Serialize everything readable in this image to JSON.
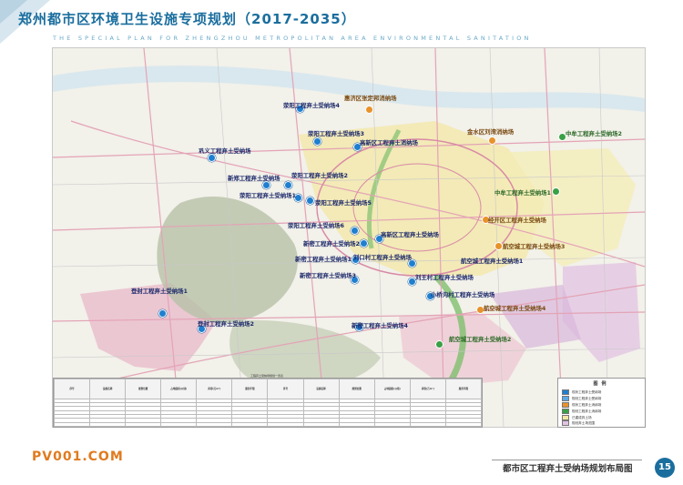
{
  "header": {
    "title": "郑州都市区环境卫生设施专项规划（2017-2035）",
    "subtitle": "THE SPECIAL PLAN FOR ZHENGZHOU METROPOLITAN AREA ENVIRONMENTAL SANITATION"
  },
  "map": {
    "labels": {
      "hjq": "惠济区张定邦消纳场",
      "xy4": "荥阳工程弃土受纳场4",
      "xy3": "荥阳工程弃土受纳场3",
      "gxq": "高新区工程弃土消纳场",
      "jsq": "金水区刘湾消纳场",
      "zm2": "中牟工程弃土受纳场2",
      "gy": "巩义工程弃土受纳场",
      "xz": "新郑工程弃土受纳场",
      "xy2": "荥阳工程弃土受纳场2",
      "xy1": "荥阳工程弃土受纳场1",
      "xy5": "荥阳工程弃土受纳场5",
      "zm1": "中牟工程弃土受纳场1",
      "gxq2": "高新区工程弃土受纳场",
      "jc": "经开区工程弃土受纳场",
      "hk3": "航空城工程弃土受纳场3",
      "xy6": "荥阳工程弃土受纳场6",
      "dq": "登封工程弃土受纳场",
      "xm2": "新密工程弃土受纳场2",
      "xm1": "新密工程弃土受纳场1",
      "lk": "刘口村工程弃土受纳场",
      "hk1": "航空城工程弃土受纳场1",
      "xm3": "新密工程弃土受纳场3",
      "lwc": "刘王村工程弃土受纳场",
      "xh": "小桥沟村工程弃土受纳场",
      "df1": "登封工程弃土受纳场1",
      "df2": "登封工程弃土受纳场2",
      "hk4": "航空城工程弃土受纳场4",
      "xm4": "新密工程弃土受纳场4",
      "hk2": "航空城工程弃土受纳场2"
    },
    "table_title": "工程弃土受纳场规划一览表",
    "table_headers": [
      "序号",
      "设施名称",
      "规划位置",
      "占地面积(公顷)",
      "库容(万m³)",
      "服务年限"
    ]
  },
  "legend": {
    "title": "图例",
    "items": [
      "现状工程弃土受纳场",
      "规划工程弃土受纳场",
      "现状工程弃土消纳场",
      "规划工程弃土消纳场",
      "已建成弃土场",
      "规划弃土场范围"
    ]
  },
  "footer": {
    "watermark": "PV001.COM",
    "title": "都市区工程弃土受纳场规划布局图",
    "page": "15"
  },
  "colors": {
    "brand": "#1a6e9e",
    "facility_blue": "#1f7fcf",
    "facility_orange": "#e8922a",
    "facility_green": "#3aa046"
  }
}
